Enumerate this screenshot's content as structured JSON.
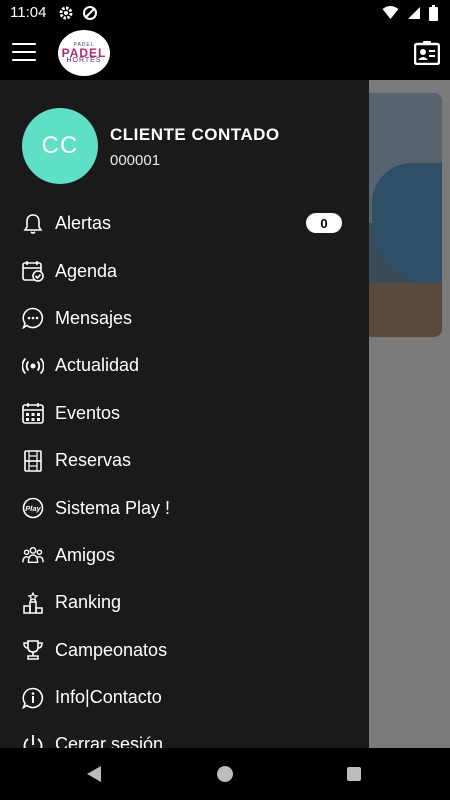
{
  "status_bar": {
    "time": "11:04"
  },
  "app_bar": {
    "logo_text_top": "PADEL",
    "logo_text_main": "PADEL",
    "logo_text_sub": "HORTES"
  },
  "user": {
    "initials": "CC",
    "name": "CLIENTE CONTADO",
    "id": "000001"
  },
  "menu": {
    "items": [
      {
        "label": "Alertas",
        "icon": "bell-icon",
        "badge": "0"
      },
      {
        "label": "Agenda",
        "icon": "calendar-check-icon"
      },
      {
        "label": "Mensajes",
        "icon": "chat-bubble-icon"
      },
      {
        "label": "Actualidad",
        "icon": "broadcast-icon"
      },
      {
        "label": "Eventos",
        "icon": "calendar-grid-icon"
      },
      {
        "label": "Reservas",
        "icon": "court-icon"
      },
      {
        "label": "Sistema Play !",
        "icon": "play-badge-icon"
      },
      {
        "label": "Amigos",
        "icon": "friends-icon"
      },
      {
        "label": "Ranking",
        "icon": "podium-icon"
      },
      {
        "label": "Campeonatos",
        "icon": "trophy-icon"
      },
      {
        "label": "Info|Contacto",
        "icon": "info-icon"
      },
      {
        "label": "Cerrar sesión",
        "icon": "power-icon"
      }
    ]
  },
  "colors": {
    "drawer_bg": "#1a1a1a",
    "avatar_bg": "#5fe0c6",
    "scrim": "#7a7a7a"
  }
}
